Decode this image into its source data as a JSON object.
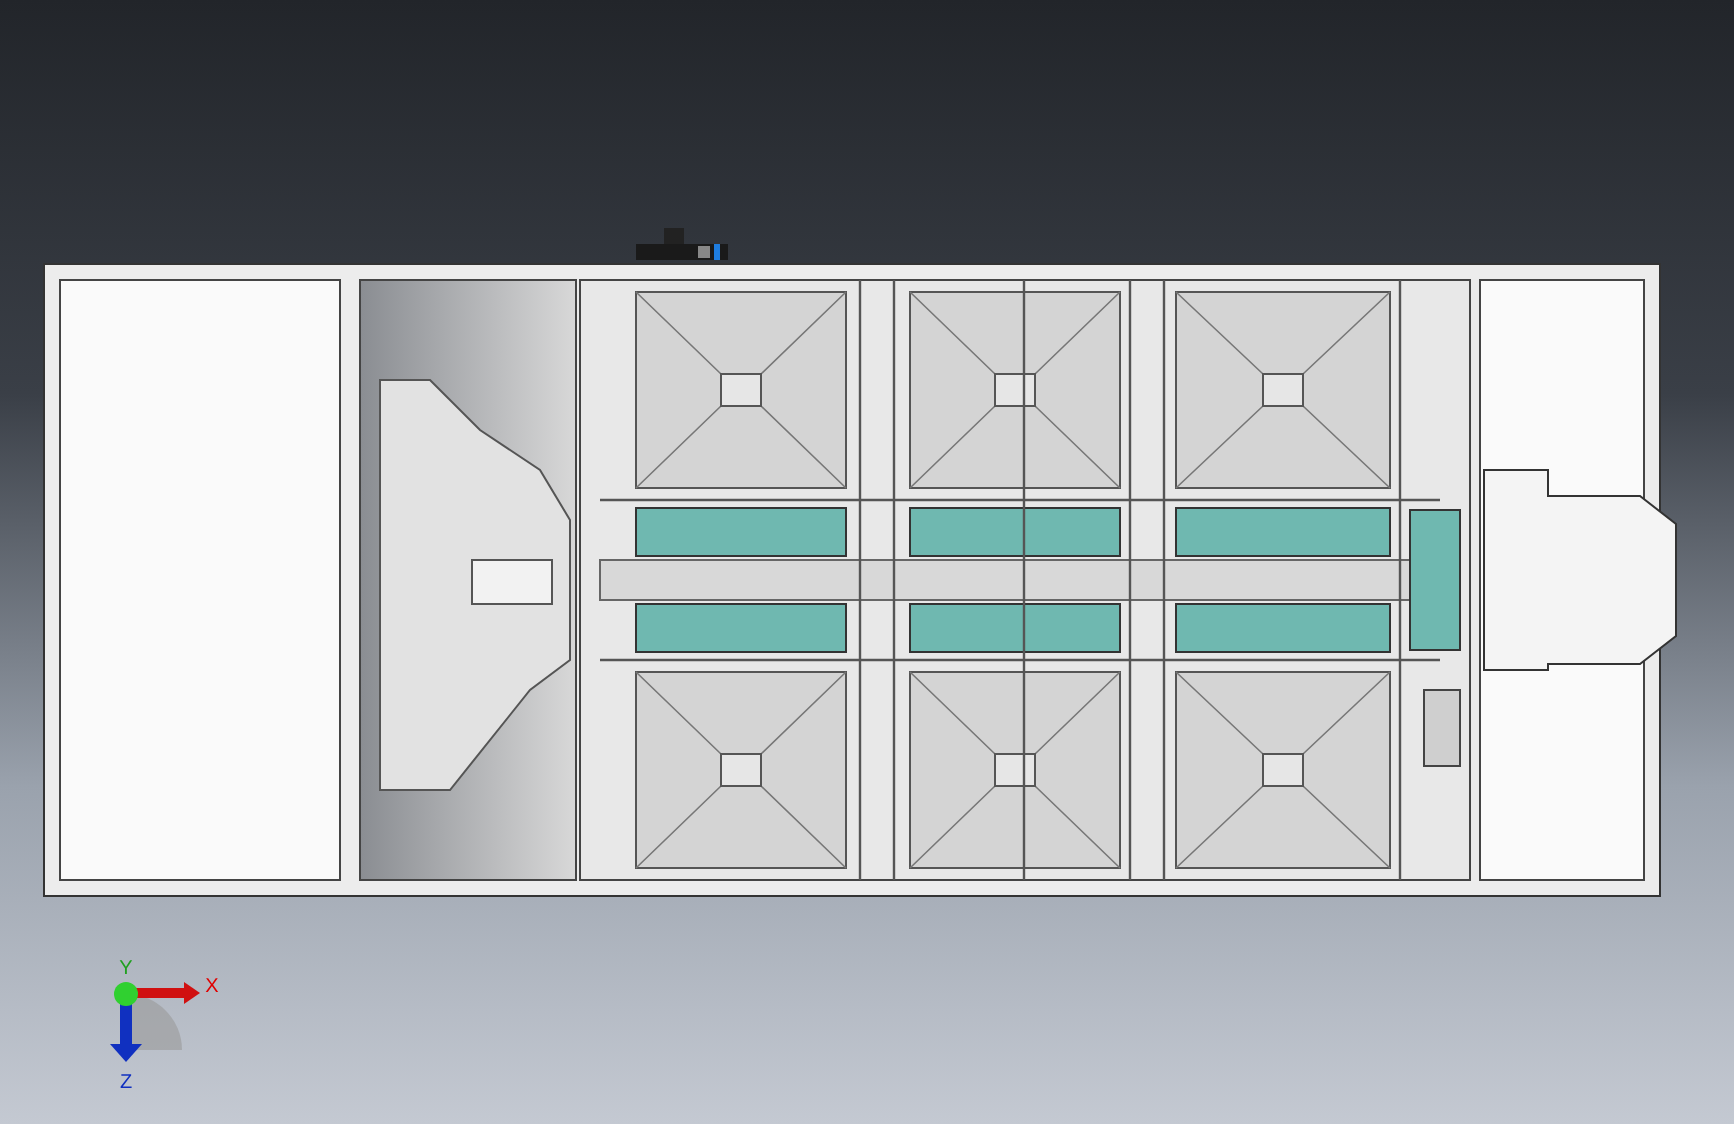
{
  "triad": {
    "labels": [
      "X",
      "Y",
      "Z"
    ]
  }
}
